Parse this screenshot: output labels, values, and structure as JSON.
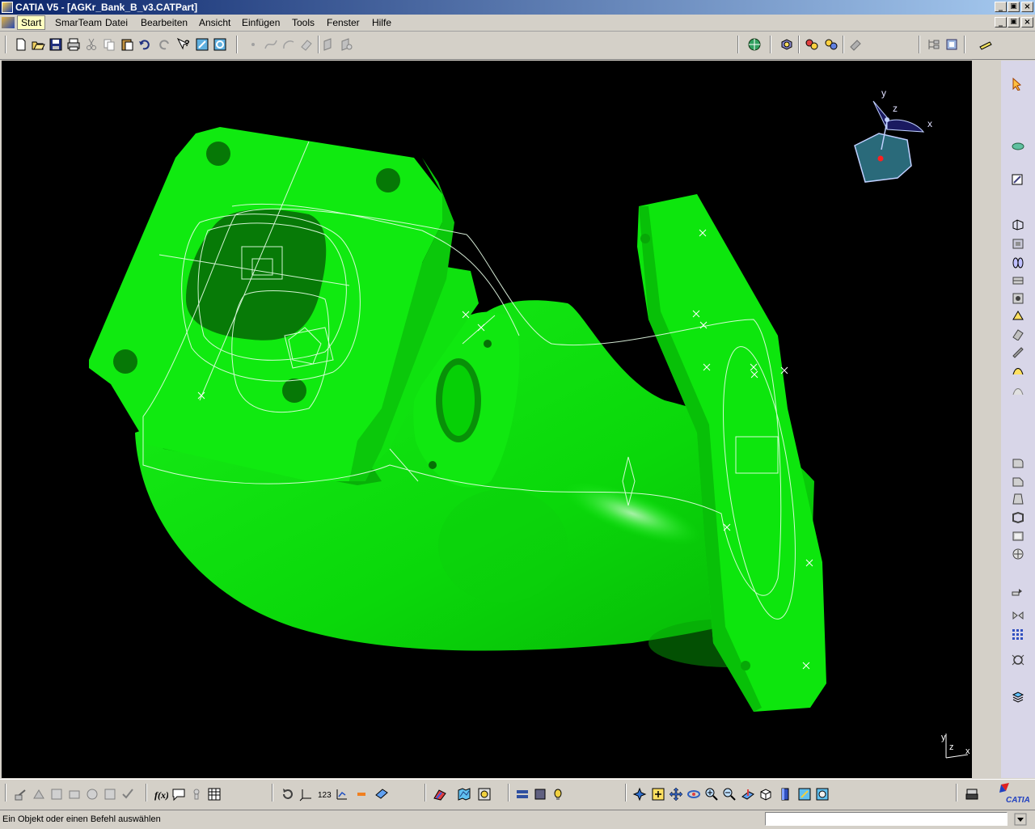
{
  "window": {
    "title": "CATIA V5 - [AGKr_Bank_B_v3.CATPart]",
    "min_label": "_",
    "max_label": "▣",
    "close_label": "×"
  },
  "menu": {
    "items": [
      "Start",
      "SmarTeam",
      "Datei",
      "Bearbeiten",
      "Ansicht",
      "Einfügen",
      "Tools",
      "Fenster",
      "Hilfe"
    ],
    "active": "Start"
  },
  "viewport": {
    "background": "#000000",
    "part_color": "#0ee80e",
    "compass_labels": {
      "x": "x",
      "y": "y",
      "z": "z"
    },
    "axis_labels": {
      "y": "y",
      "z": "z",
      "x": "x"
    }
  },
  "statusbar": {
    "prompt": "Ein Objekt oder einen Befehl auswählen",
    "command_value": ""
  },
  "logo": {
    "text": "CATIA"
  },
  "icons": {
    "standard": [
      "new-icon",
      "open-icon",
      "save-icon",
      "print-icon",
      "cut-icon",
      "copy-icon",
      "paste-icon",
      "undo-icon",
      "redo-icon",
      "whats-this-icon",
      "sketcher-icon",
      "sketcher-alt-icon",
      "point-icon",
      "spline-icon",
      "arc-icon",
      "erase-icon",
      "plane-icon",
      "plane-alt-icon"
    ],
    "right": [
      "select-icon",
      "view-icon",
      "sketch-icon",
      "pad-icon",
      "pocket-icon",
      "shaft-icon",
      "groove-icon",
      "hole-icon",
      "rib-icon",
      "slot-icon",
      "stiffener-icon",
      "loft-icon",
      "remove-loft-icon",
      "fillet-icon",
      "chamfer-icon",
      "draft-icon",
      "shell-icon",
      "thickness-icon",
      "thread-icon",
      "translate-icon",
      "mirror-icon",
      "pattern-icon",
      "scale-icon",
      "boolean-icon"
    ],
    "bottom": [
      "measure-icon",
      "apply-material-icon",
      "formula-icon",
      "knowledge-icon",
      "table-icon",
      "update-icon",
      "axis-system-icon",
      "analysis-icon",
      "fly-icon",
      "fit-all-icon",
      "pan-icon",
      "rotate-icon",
      "zoom-in-icon",
      "zoom-out-icon",
      "normal-view-icon",
      "iso-view-icon",
      "shading-icon",
      "hide-show-icon",
      "swap-icon"
    ]
  }
}
